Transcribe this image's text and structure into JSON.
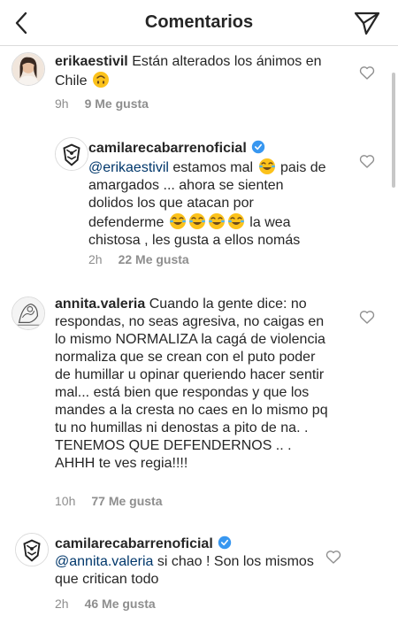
{
  "header": {
    "title": "Comentarios",
    "back_icon": "chevron-left-icon",
    "send_icon": "paper-plane-icon"
  },
  "comments": [
    {
      "username": "erikaestivil",
      "text": "Están alterados los ánimos en Chile",
      "emoji": "upside-down-face",
      "time": "9h",
      "likes": "9 Me gusta"
    },
    {
      "username": "camilarecabarrenoficial",
      "verified": true,
      "mention": "@erikaestivil",
      "text_a": " estamos mal ",
      "text_b": " pais de amargados ... ahora se sienten dolidos los que atacan por defenderme ",
      "text_c": " la wea chistosa , les gusta a ellos nomás",
      "emoji": "face-with-tears-of-joy",
      "time": "2h",
      "likes": "22 Me gusta"
    },
    {
      "username": "annita.valeria",
      "text": "Cuando la gente dice: no respondas, no seas agresiva, no caigas en lo mismo NORMALIZA la cagá de violencia normaliza que se crean con el puto poder de humillar u opinar queriendo hacer sentir mal... está bien que respondas y que los mandes a la cresta no caes en lo mismo pq tu no humillas ni denostas a pito de na. . TENEMOS QUE DEFENDERNOS .. . AHHH te ves regia!!!!",
      "time": "10h",
      "likes": "77 Me gusta"
    },
    {
      "username": "camilarecabarrenoficial",
      "verified": true,
      "mention": "@annita.valeria",
      "text": " si chao ! Son los mismos  que critican todo",
      "time": "2h",
      "likes": "46 Me gusta"
    }
  ],
  "colors": {
    "text": "#262626",
    "meta": "#8e8e8e",
    "mention": "#00376b",
    "verified": "#3897f0",
    "divider": "#dbdbdb"
  }
}
